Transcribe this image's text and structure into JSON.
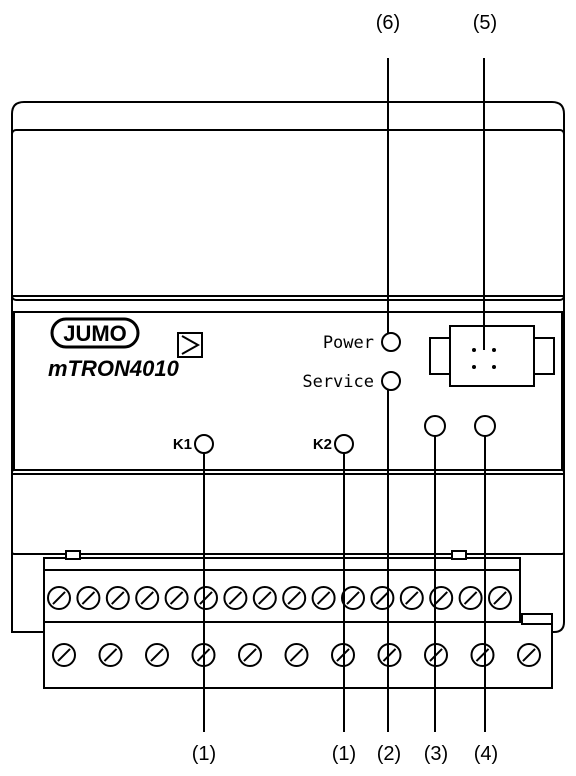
{
  "callouts_top": {
    "c6": "(6)",
    "c5": "(5)"
  },
  "callouts_bottom": {
    "c1a": "(1)",
    "c1b": "(1)",
    "c2": "(2)",
    "c3": "(3)",
    "c4": "(4)"
  },
  "front_panel": {
    "logo_text": "JUMO",
    "product_logo": "mTRON4010",
    "labels": {
      "power": "Power",
      "service": "Service",
      "k1": "K1",
      "k2": "K2"
    }
  },
  "icons": [
    "play-arrow-icon",
    "led-indicator",
    "service-connector",
    "screw-terminal"
  ]
}
